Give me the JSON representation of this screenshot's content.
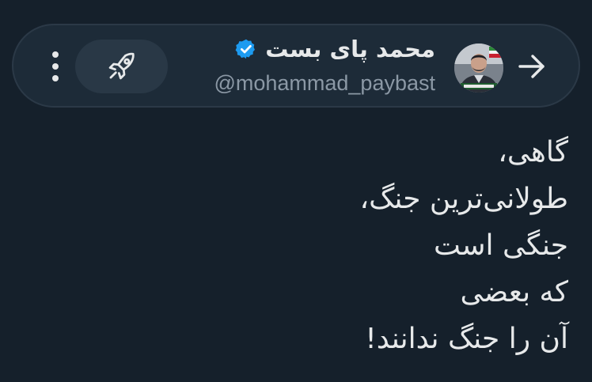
{
  "header": {
    "display_name": "محمد پای بست",
    "handle": "@mohammad_paybast",
    "verified_icon": "verified-badge-icon",
    "back_icon": "arrow-right-icon",
    "boost_icon": "rocket-icon",
    "more_icon": "vertical-ellipsis-icon"
  },
  "post": {
    "lines": [
      "گاهی،",
      "طولانی‌ترین جنگ،",
      "جنگی است",
      "که بعضی",
      "آن را جنگ ندانند!"
    ]
  },
  "colors": {
    "background": "#15202b",
    "header_bar": "#1d2b38",
    "text_primary": "#e7e9ea",
    "text_secondary": "#8b98a5",
    "verified": "#1d9bf0"
  }
}
